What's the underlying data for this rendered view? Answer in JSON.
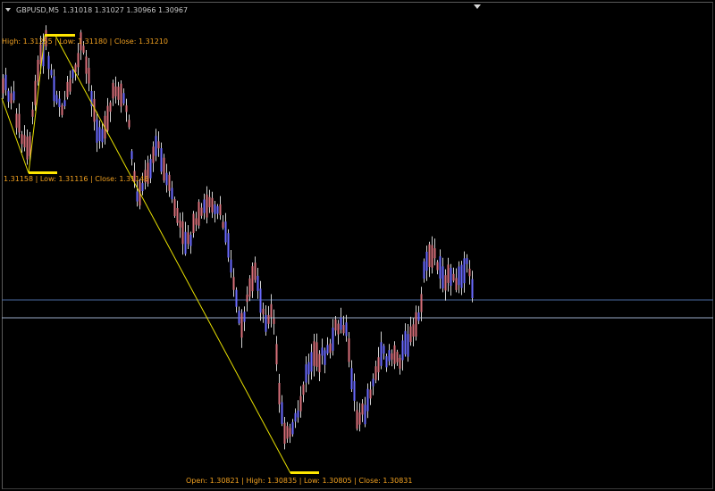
{
  "window": {
    "symbol_label": "GBPUSD,M5",
    "ohlc_label": "1.31018 1.31027 1.30966 1.30967"
  },
  "annotations": {
    "high_label": "High: 1.31255 | Low: 1.31180 | Close: 1.31210",
    "low1_label": "1.31158 | Low: 1.31116 | Close: 1.31146",
    "bottom_label": "Open: 1.30821 | High: 1.30835 | Low: 1.30805 | Close: 1.30831"
  },
  "colors": {
    "background": "#000000",
    "bull_candle": "#6a6aff",
    "bear_candle": "#d8707a",
    "wick": "#d0d0d0",
    "zigzag": "#e8e000",
    "level_marker": "#ffe600",
    "hline_1": "#4a6aa0",
    "hline_2": "#9aaac8",
    "label_text": "#f0a020"
  },
  "icons": {
    "menu": "triangle-down-icon",
    "scroll": "triangle-down-icon"
  }
}
